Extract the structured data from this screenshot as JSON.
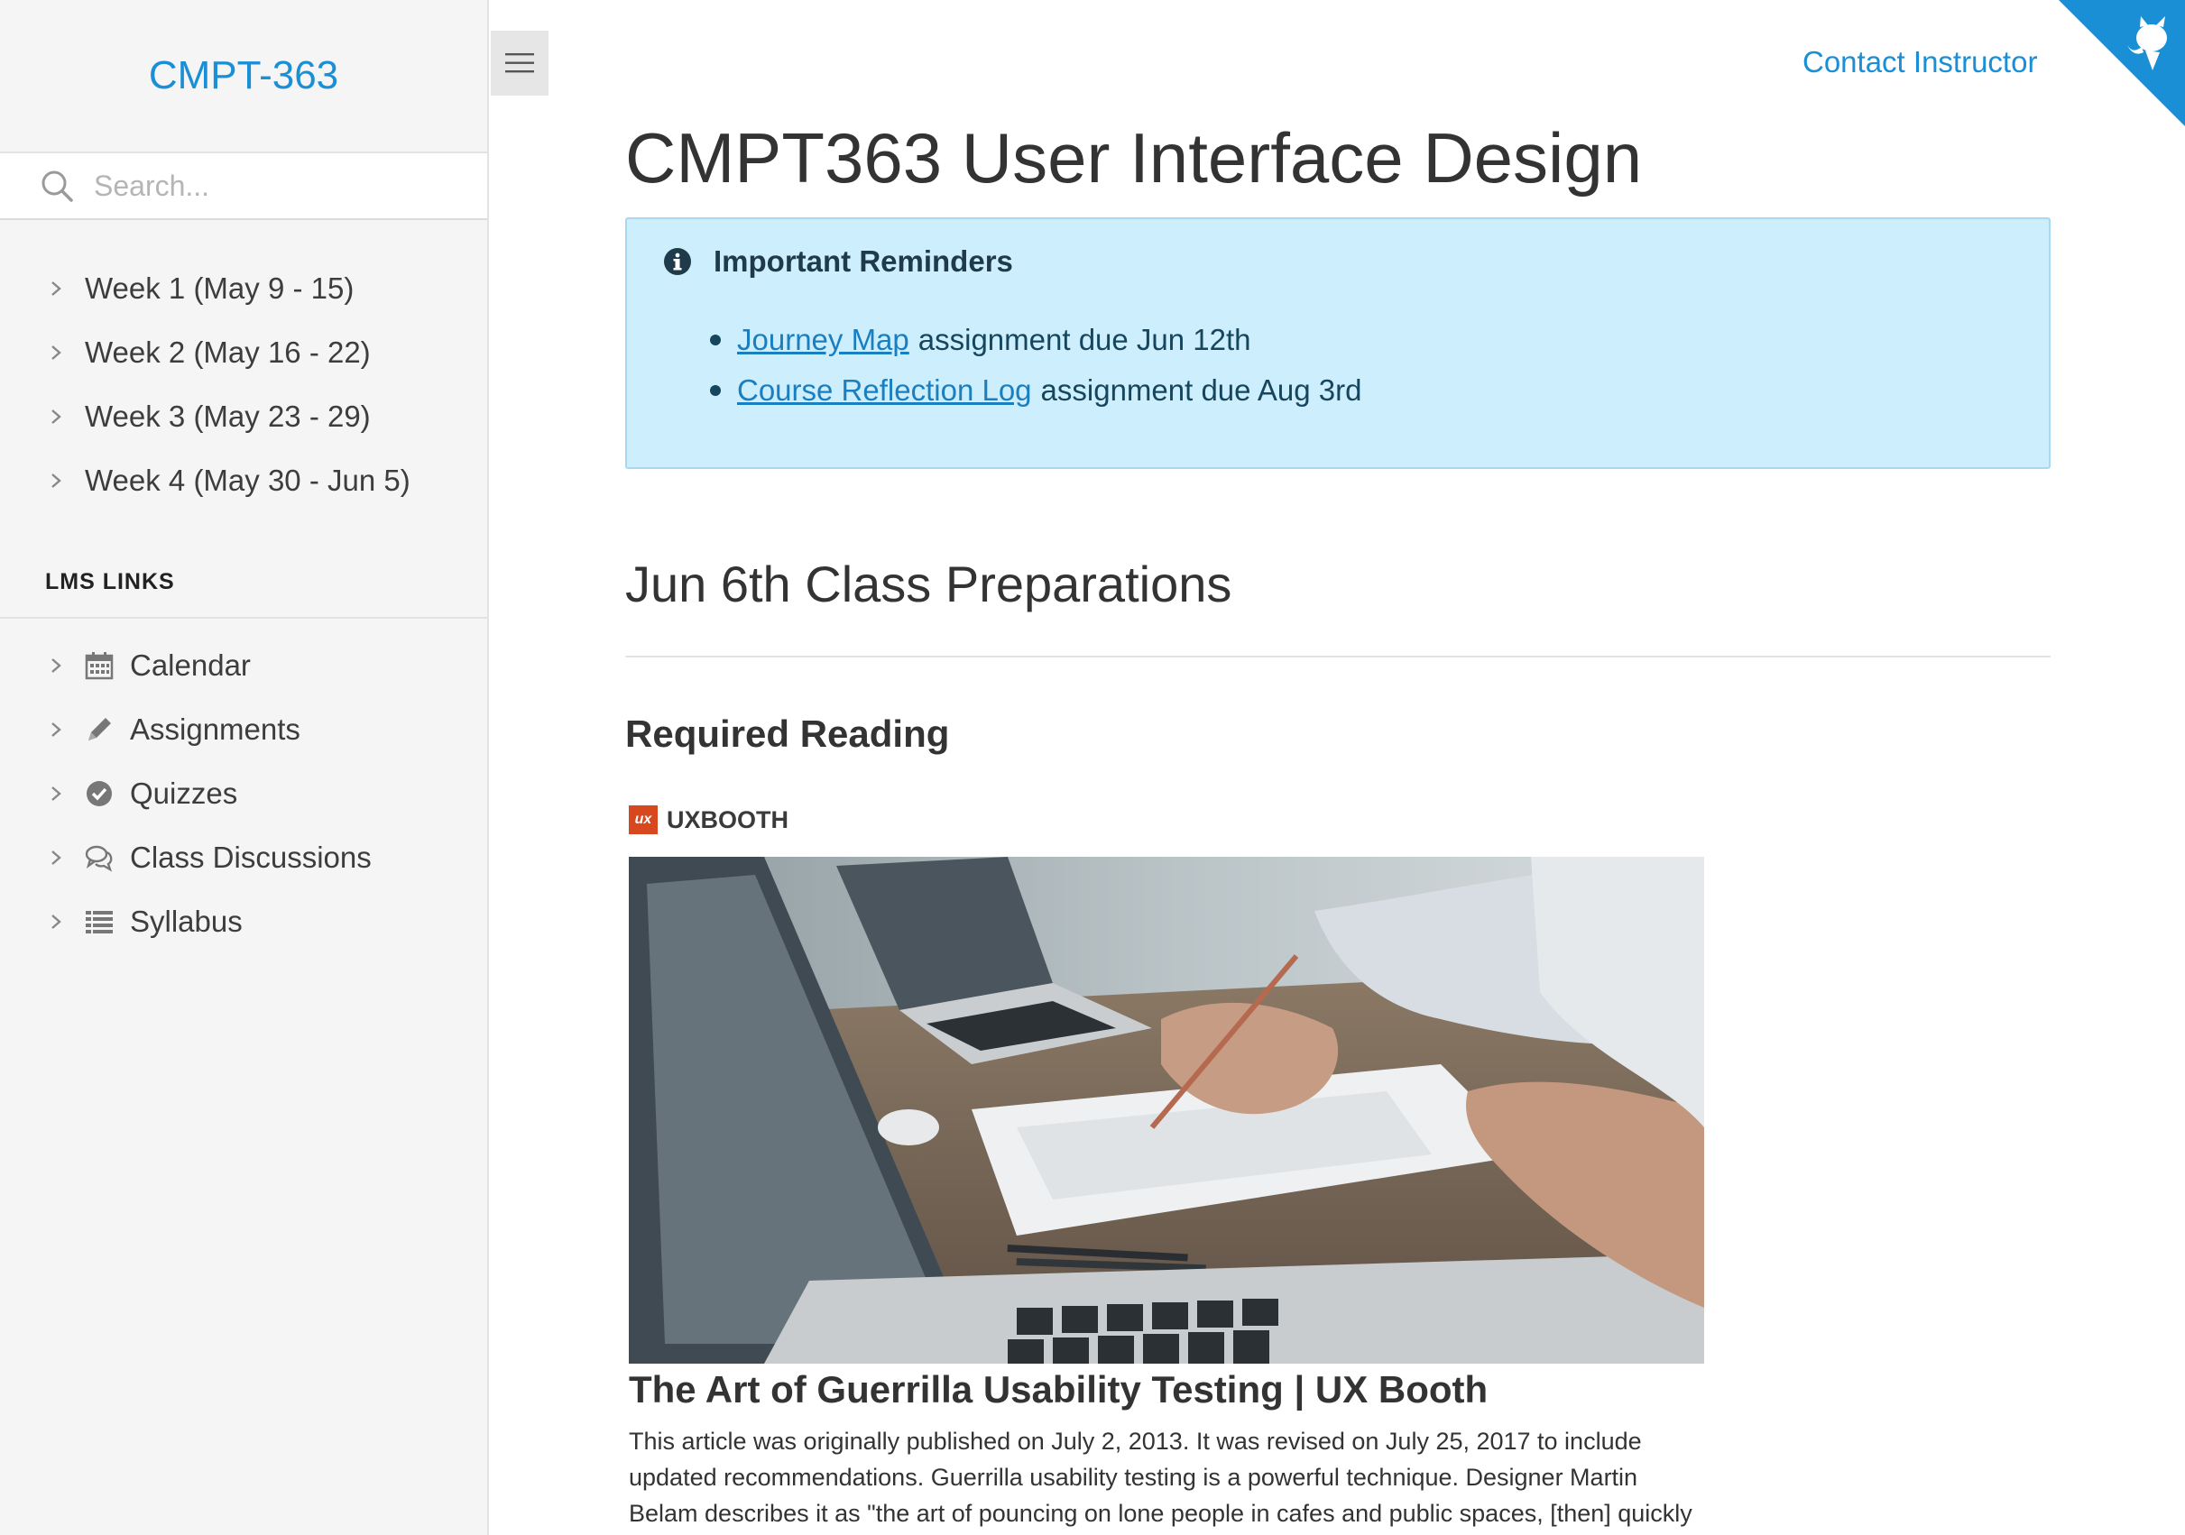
{
  "sidebar": {
    "brand": "CMPT-363",
    "search_placeholder": "Search...",
    "weeks": [
      {
        "label": "Week 1 (May 9 - 15)"
      },
      {
        "label": "Week 2 (May 16 - 22)"
      },
      {
        "label": "Week 3 (May 23 - 29)"
      },
      {
        "label": "Week 4 (May 30 - Jun 5)"
      }
    ],
    "lms_heading": "LMS LINKS",
    "lms_links": [
      {
        "label": "Calendar",
        "icon": "calendar-icon"
      },
      {
        "label": "Assignments",
        "icon": "pencil-icon"
      },
      {
        "label": "Quizzes",
        "icon": "check-circle-icon"
      },
      {
        "label": "Class Discussions",
        "icon": "comments-icon"
      },
      {
        "label": "Syllabus",
        "icon": "list-icon"
      }
    ]
  },
  "header": {
    "contact_label": "Contact Instructor",
    "corner_icon": "github-octocat-icon"
  },
  "main": {
    "title": "CMPT363 User Interface Design",
    "notice": {
      "heading": "Important Reminders",
      "icon": "info-circle-icon",
      "items": [
        {
          "link": "Journey Map",
          "text": "assignment due Jun 12th"
        },
        {
          "link": "Course Reflection Log",
          "text": "assignment due Aug 3rd"
        }
      ]
    },
    "section_title": "Jun 6th Class Preparations",
    "reading_title": "Required Reading",
    "article": {
      "source_logo": "ux",
      "source": "UXBOOTH",
      "title": "The Art of Guerrilla Usability Testing | UX Booth",
      "description": "This article was originally published on July 2, 2013. It was revised on July 25, 2017 to include updated recommendations. Guerrilla usability testing is a powerful technique. Designer Martin Belam describes it as \"the art of pouncing on lone people in cafes and public spaces, [then] quickly filming"
    }
  },
  "colors": {
    "accent": "#1a8fd6",
    "sidebar_bg": "#f5f5f5",
    "notice_bg": "#cdeefc",
    "notice_border": "#a9d9f2",
    "corner": "#1a8fd6"
  }
}
